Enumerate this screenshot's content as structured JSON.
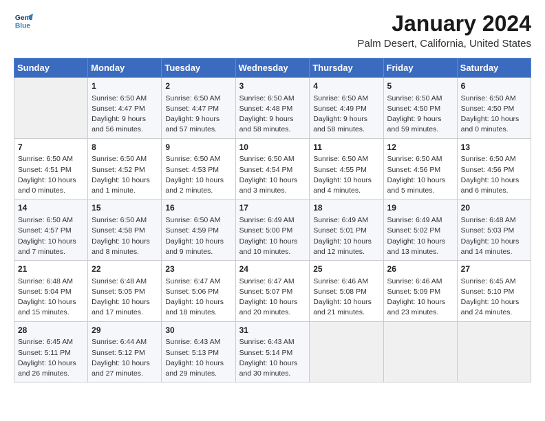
{
  "logo": {
    "line1": "General",
    "line2": "Blue"
  },
  "title": "January 2024",
  "subtitle": "Palm Desert, California, United States",
  "days_of_week": [
    "Sunday",
    "Monday",
    "Tuesday",
    "Wednesday",
    "Thursday",
    "Friday",
    "Saturday"
  ],
  "weeks": [
    [
      {
        "day": "",
        "info": ""
      },
      {
        "day": "1",
        "info": "Sunrise: 6:50 AM\nSunset: 4:47 PM\nDaylight: 9 hours\nand 56 minutes."
      },
      {
        "day": "2",
        "info": "Sunrise: 6:50 AM\nSunset: 4:47 PM\nDaylight: 9 hours\nand 57 minutes."
      },
      {
        "day": "3",
        "info": "Sunrise: 6:50 AM\nSunset: 4:48 PM\nDaylight: 9 hours\nand 58 minutes."
      },
      {
        "day": "4",
        "info": "Sunrise: 6:50 AM\nSunset: 4:49 PM\nDaylight: 9 hours\nand 58 minutes."
      },
      {
        "day": "5",
        "info": "Sunrise: 6:50 AM\nSunset: 4:50 PM\nDaylight: 9 hours\nand 59 minutes."
      },
      {
        "day": "6",
        "info": "Sunrise: 6:50 AM\nSunset: 4:50 PM\nDaylight: 10 hours\nand 0 minutes."
      }
    ],
    [
      {
        "day": "7",
        "info": "Sunrise: 6:50 AM\nSunset: 4:51 PM\nDaylight: 10 hours\nand 0 minutes."
      },
      {
        "day": "8",
        "info": "Sunrise: 6:50 AM\nSunset: 4:52 PM\nDaylight: 10 hours\nand 1 minute."
      },
      {
        "day": "9",
        "info": "Sunrise: 6:50 AM\nSunset: 4:53 PM\nDaylight: 10 hours\nand 2 minutes."
      },
      {
        "day": "10",
        "info": "Sunrise: 6:50 AM\nSunset: 4:54 PM\nDaylight: 10 hours\nand 3 minutes."
      },
      {
        "day": "11",
        "info": "Sunrise: 6:50 AM\nSunset: 4:55 PM\nDaylight: 10 hours\nand 4 minutes."
      },
      {
        "day": "12",
        "info": "Sunrise: 6:50 AM\nSunset: 4:56 PM\nDaylight: 10 hours\nand 5 minutes."
      },
      {
        "day": "13",
        "info": "Sunrise: 6:50 AM\nSunset: 4:56 PM\nDaylight: 10 hours\nand 6 minutes."
      }
    ],
    [
      {
        "day": "14",
        "info": "Sunrise: 6:50 AM\nSunset: 4:57 PM\nDaylight: 10 hours\nand 7 minutes."
      },
      {
        "day": "15",
        "info": "Sunrise: 6:50 AM\nSunset: 4:58 PM\nDaylight: 10 hours\nand 8 minutes."
      },
      {
        "day": "16",
        "info": "Sunrise: 6:50 AM\nSunset: 4:59 PM\nDaylight: 10 hours\nand 9 minutes."
      },
      {
        "day": "17",
        "info": "Sunrise: 6:49 AM\nSunset: 5:00 PM\nDaylight: 10 hours\nand 10 minutes."
      },
      {
        "day": "18",
        "info": "Sunrise: 6:49 AM\nSunset: 5:01 PM\nDaylight: 10 hours\nand 12 minutes."
      },
      {
        "day": "19",
        "info": "Sunrise: 6:49 AM\nSunset: 5:02 PM\nDaylight: 10 hours\nand 13 minutes."
      },
      {
        "day": "20",
        "info": "Sunrise: 6:48 AM\nSunset: 5:03 PM\nDaylight: 10 hours\nand 14 minutes."
      }
    ],
    [
      {
        "day": "21",
        "info": "Sunrise: 6:48 AM\nSunset: 5:04 PM\nDaylight: 10 hours\nand 15 minutes."
      },
      {
        "day": "22",
        "info": "Sunrise: 6:48 AM\nSunset: 5:05 PM\nDaylight: 10 hours\nand 17 minutes."
      },
      {
        "day": "23",
        "info": "Sunrise: 6:47 AM\nSunset: 5:06 PM\nDaylight: 10 hours\nand 18 minutes."
      },
      {
        "day": "24",
        "info": "Sunrise: 6:47 AM\nSunset: 5:07 PM\nDaylight: 10 hours\nand 20 minutes."
      },
      {
        "day": "25",
        "info": "Sunrise: 6:46 AM\nSunset: 5:08 PM\nDaylight: 10 hours\nand 21 minutes."
      },
      {
        "day": "26",
        "info": "Sunrise: 6:46 AM\nSunset: 5:09 PM\nDaylight: 10 hours\nand 23 minutes."
      },
      {
        "day": "27",
        "info": "Sunrise: 6:45 AM\nSunset: 5:10 PM\nDaylight: 10 hours\nand 24 minutes."
      }
    ],
    [
      {
        "day": "28",
        "info": "Sunrise: 6:45 AM\nSunset: 5:11 PM\nDaylight: 10 hours\nand 26 minutes."
      },
      {
        "day": "29",
        "info": "Sunrise: 6:44 AM\nSunset: 5:12 PM\nDaylight: 10 hours\nand 27 minutes."
      },
      {
        "day": "30",
        "info": "Sunrise: 6:43 AM\nSunset: 5:13 PM\nDaylight: 10 hours\nand 29 minutes."
      },
      {
        "day": "31",
        "info": "Sunrise: 6:43 AM\nSunset: 5:14 PM\nDaylight: 10 hours\nand 30 minutes."
      },
      {
        "day": "",
        "info": ""
      },
      {
        "day": "",
        "info": ""
      },
      {
        "day": "",
        "info": ""
      }
    ]
  ]
}
